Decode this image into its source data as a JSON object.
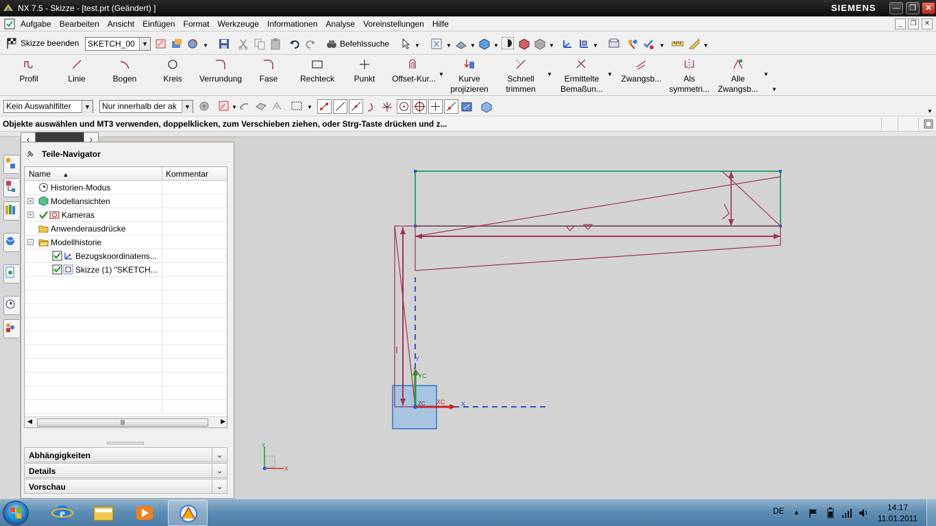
{
  "window": {
    "title": "NX 7.5 - Skizze - [test.prt (Geändert) ]",
    "brand": "SIEMENS"
  },
  "menubar": {
    "items": [
      "Aufgabe",
      "Bearbeiten",
      "Ansicht",
      "Einfügen",
      "Format",
      "Werkzeuge",
      "Informationen",
      "Analyse",
      "Voreinstellungen",
      "Hilfe"
    ]
  },
  "toolbar": {
    "finish_sketch": "Skizze beenden",
    "sketch_name": "SKETCH_00",
    "command_search": "Befehlssuche"
  },
  "ribbon": {
    "profil": "Profil",
    "linie": "Linie",
    "bogen": "Bogen",
    "kreis": "Kreis",
    "verrundung": "Verrundung",
    "fase": "Fase",
    "rechteck": "Rechteck",
    "punkt": "Punkt",
    "offset": "Offset-Kur...",
    "kurve_1": "Kurve",
    "kurve_2": "projizieren",
    "schnell_1": "Schnell",
    "schnell_2": "trimmen",
    "bemass_1": "Ermittelte",
    "bemass_2": "Bemaßun...",
    "zwang": "Zwangsb...",
    "sym_1": "Als",
    "sym_2": "symmetri...",
    "alle_1": "Alle",
    "alle_2": "Zwangsb..."
  },
  "filterbar": {
    "filter_value": "Kein Auswahlfilter",
    "scope_value": "Nur innerhalb der ak"
  },
  "status": {
    "message": "Objekte auswählen und MT3 verwenden, doppelklicken, zum Verschieben ziehen, oder Strg-Taste drücken und z..."
  },
  "navigator": {
    "title": "Teile-Navigator",
    "col_name": "Name",
    "col_comment": "Kommentar",
    "nodes": [
      {
        "label": "Historien-Modus"
      },
      {
        "label": "Modellansichten"
      },
      {
        "label": "Kameras"
      },
      {
        "label": "Anwenderausdrücke"
      },
      {
        "label": "Modellhistorie"
      },
      {
        "label": "Bezugskoordinatens..."
      },
      {
        "label": "Skizze (1) \"SKETCH..."
      }
    ],
    "panels": [
      "Abhängigkeiten",
      "Details",
      "Vorschau"
    ]
  },
  "graphics": {
    "axis_y": "Y",
    "axis_yc": "YC",
    "axis_xc": "XC",
    "axis_x": "X",
    "axis_zc": "ZC",
    "triad_y": "Y",
    "triad_x": "X"
  },
  "taskbar": {
    "language": "DE",
    "time": "14:17",
    "date": "11.01.2011"
  },
  "colors": {
    "sketch_curve": "#a0305a",
    "selection_green": "#1f9a6a",
    "csys_blue": "#2a56d0",
    "plane_fill": "#a9c4e0"
  }
}
